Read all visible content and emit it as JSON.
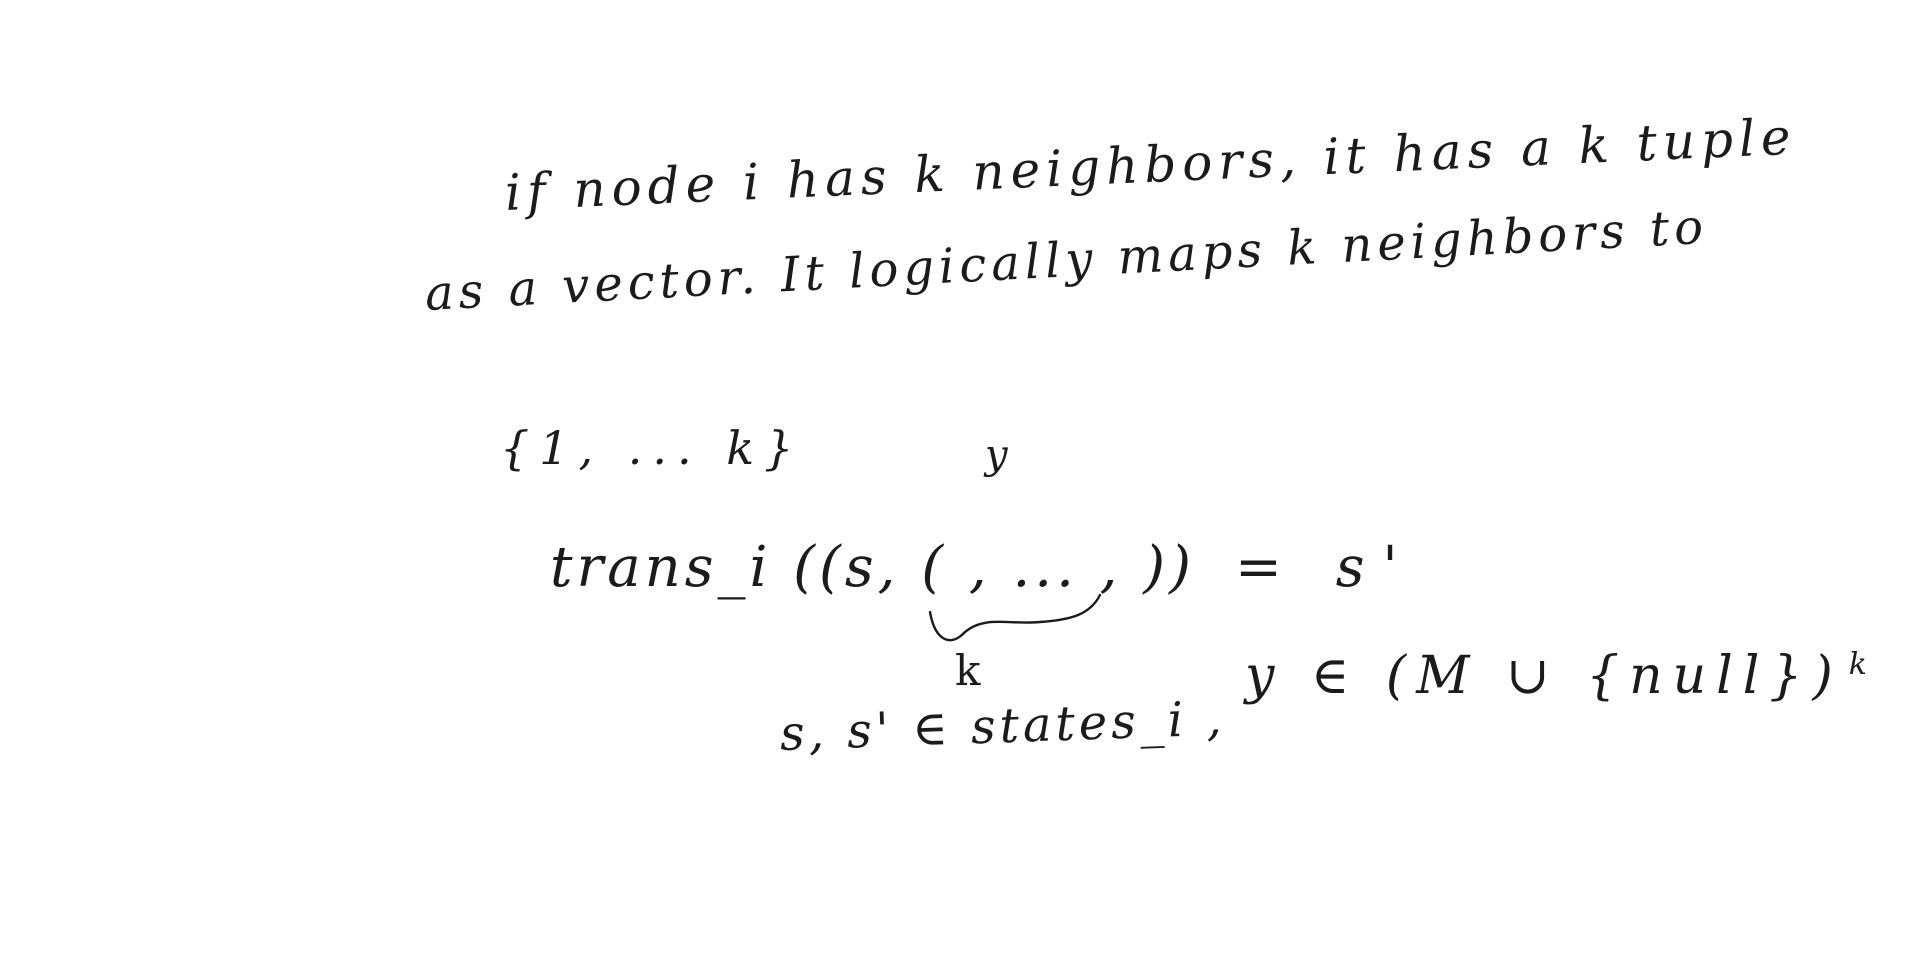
{
  "note": {
    "line1": "if node i has k neighbors, it has a k tuple",
    "line2": "as a vector. It logically maps k neighbors to",
    "line3": "{1, ... k}",
    "line4_lhs": "trans_i ((s, ( , ... , ))",
    "line4_rhs": "= s'",
    "y_above": "y",
    "k_below": "k",
    "line5": "s, s' ∈ states_i ,",
    "line6": "y ∈ (M ∪ {null})",
    "line6_exp": "k"
  }
}
